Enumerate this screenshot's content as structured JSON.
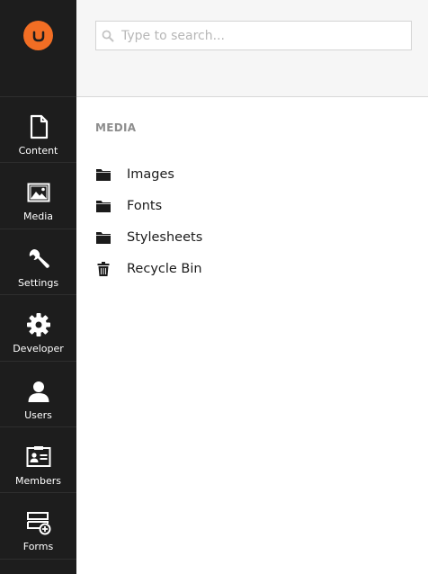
{
  "sidebar": {
    "logo": "umbraco-logo",
    "brand_color": "#f26e24",
    "items": [
      {
        "label": "Content",
        "icon": "document-icon"
      },
      {
        "label": "Media",
        "icon": "image-icon"
      },
      {
        "label": "Settings",
        "icon": "wrench-icon"
      },
      {
        "label": "Developer",
        "icon": "gear-icon"
      },
      {
        "label": "Users",
        "icon": "user-icon"
      },
      {
        "label": "Members",
        "icon": "id-card-icon"
      },
      {
        "label": "Forms",
        "icon": "form-add-icon"
      }
    ]
  },
  "search": {
    "placeholder": "Type to search..."
  },
  "main": {
    "section_title": "MEDIA",
    "tree": [
      {
        "label": "Images",
        "icon": "folder-icon"
      },
      {
        "label": "Fonts",
        "icon": "folder-icon"
      },
      {
        "label": "Stylesheets",
        "icon": "folder-icon"
      },
      {
        "label": "Recycle Bin",
        "icon": "trash-icon"
      }
    ]
  }
}
